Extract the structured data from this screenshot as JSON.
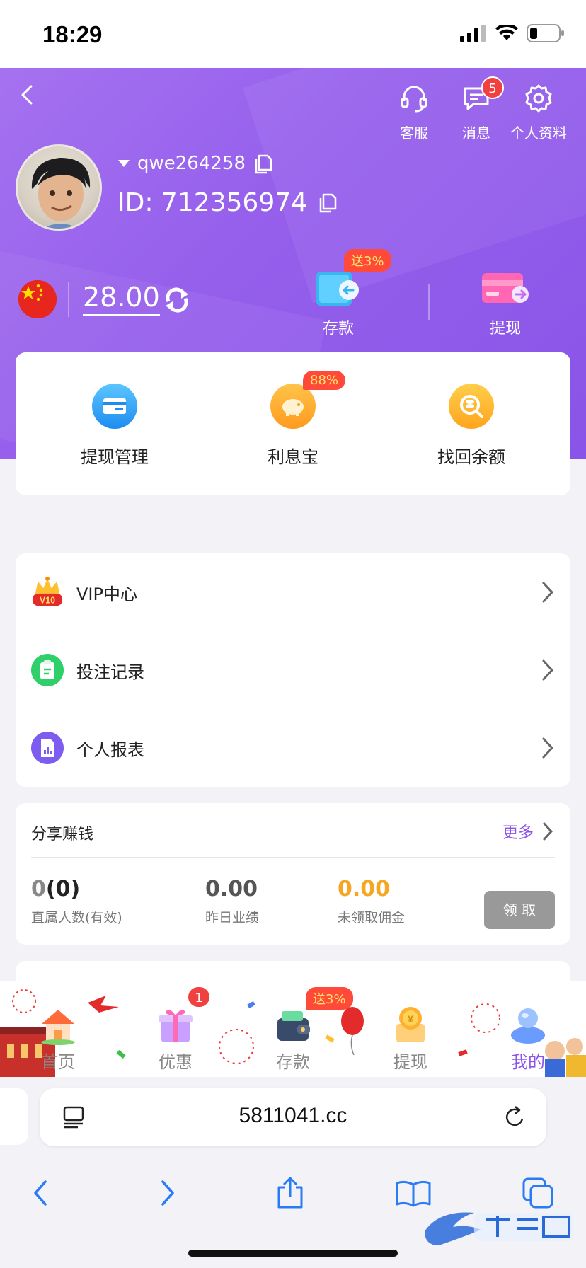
{
  "status_bar": {
    "time": "18:29"
  },
  "header": {
    "top_actions": [
      {
        "label": "客服",
        "icon": "headset-icon"
      },
      {
        "label": "消息",
        "icon": "message-icon",
        "badge": "5"
      },
      {
        "label": "个人资料",
        "icon": "gear-icon"
      }
    ],
    "username": "qwe264258",
    "user_id": "ID: 712356974",
    "balance": "28.00",
    "fund_actions": [
      {
        "label": "存款",
        "badge": "送3%"
      },
      {
        "label": "提现"
      }
    ]
  },
  "quick_actions": [
    {
      "label": "提现管理",
      "icon": "card-icon"
    },
    {
      "label": "利息宝",
      "icon": "piggy-bank-icon",
      "badge": "88%"
    },
    {
      "label": "找回余额",
      "icon": "search-coins-icon"
    }
  ],
  "menu": [
    {
      "label": "VIP中心",
      "icon": "crown-icon",
      "vip_level": "V10"
    },
    {
      "label": "投注记录",
      "icon": "clipboard-icon"
    },
    {
      "label": "个人报表",
      "icon": "report-icon"
    }
  ],
  "share": {
    "title": "分享赚钱",
    "more": "更多",
    "stats": [
      {
        "value_a": "0",
        "value_b": "(0)",
        "label": "直属人数(有效)"
      },
      {
        "value": "0.00",
        "label": "昨日业绩"
      },
      {
        "value": "0.00",
        "label": "未领取佣金"
      }
    ],
    "claim": "领 取"
  },
  "tabbar": [
    {
      "label": "首页"
    },
    {
      "label": "优惠",
      "badge": "1"
    },
    {
      "label": "存款",
      "badge": "送3%"
    },
    {
      "label": "提现"
    },
    {
      "label": "我的",
      "active": true
    }
  ],
  "browser": {
    "url": "5811041.cc"
  },
  "colors": {
    "accent": "#8a54e8",
    "header_gradient_start": "#a572f0",
    "badge_red": "#f04040",
    "orange_value": "#f5a623"
  }
}
